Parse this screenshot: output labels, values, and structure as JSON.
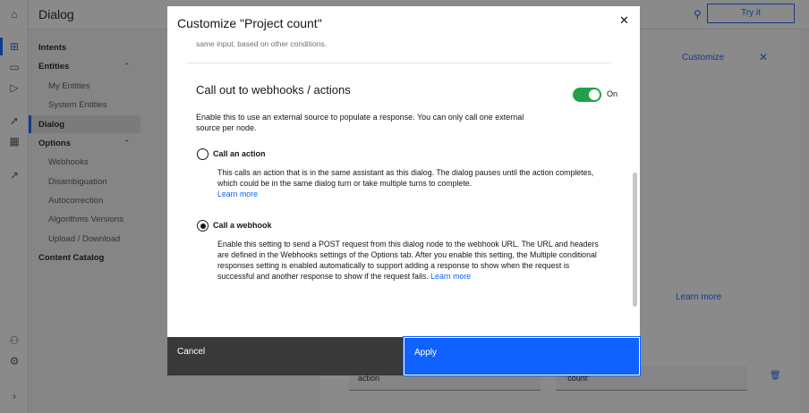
{
  "app": {
    "title": "Dialog",
    "try_it": "Try it"
  },
  "rail_icons": [
    "home-icon",
    "dialog-icon",
    "analytics-icon",
    "play-icon",
    "publish-icon",
    "integrations-icon",
    "chart-icon",
    "users-icon",
    "settings-icon",
    "expand-icon"
  ],
  "sidenav": {
    "intents": "Intents",
    "entities": "Entities",
    "my_entities": "My Entities",
    "system_entities": "System Entities",
    "dialog": "Dialog",
    "options": "Options",
    "webhooks": "Webhooks",
    "disambiguation": "Disambiguation",
    "autocorrection": "Autocorrection",
    "algorithms_versions": "Algorithms Versions",
    "upload_download": "Upload / Download",
    "content_catalog": "Content Catalog"
  },
  "panel": {
    "customize": "Customize",
    "learn_more": "Learn more",
    "field_action": "action",
    "field_count": "\"count\""
  },
  "modal": {
    "title": "Customize \"Project count\"",
    "cut_text": "same input, based on other conditions.",
    "section_title": "Call out to webhooks / actions",
    "toggle_label": "On",
    "description": "Enable this to use an external source to populate a response. You can only call one external source per node.",
    "option_action": {
      "label": "Call an action",
      "description": "This calls an action that is in the same assistant as this dialog. The dialog pauses until the action completes, which could be in the same dialog turn or take multiple turns to complete.",
      "link": "Learn more",
      "selected": false
    },
    "option_webhook": {
      "label": "Call a webhook",
      "description": "Enable this setting to send a POST request from this dialog node to the webhook URL. The URL and headers are defined in the Webhooks settings of the Options tab. After you enable this setting, the Multiple conditional responses setting is enabled automatically to support adding a response to show when the request is successful and another response to show if the request fails.",
      "link": "Learn more",
      "selected": true
    },
    "cancel": "Cancel",
    "apply": "Apply"
  },
  "colors": {
    "primary": "#0f62fe",
    "toggle_on": "#24a148",
    "cancel_bg": "#393939"
  }
}
